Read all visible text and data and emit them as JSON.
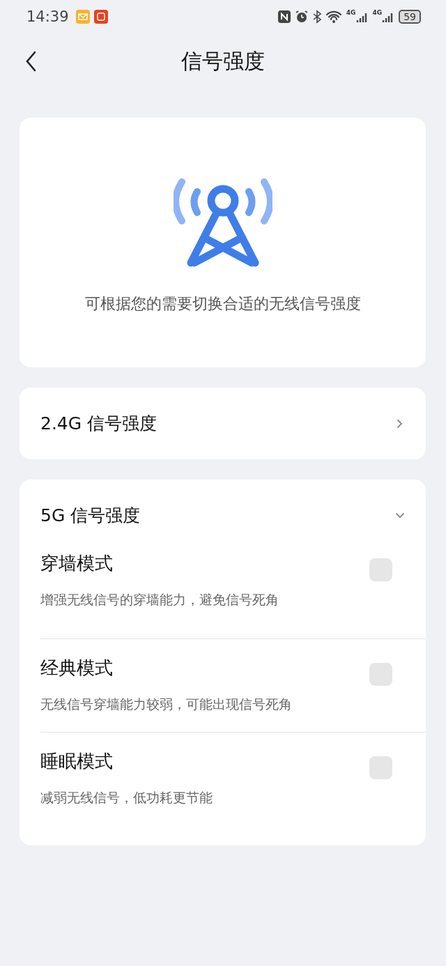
{
  "status_bar": {
    "time": "14:39",
    "signal_labels": [
      "4G",
      "4G"
    ],
    "battery": "59"
  },
  "header": {
    "title": "信号强度"
  },
  "intro": {
    "description": "可根据您的需要切换合适的无线信号强度"
  },
  "bands": [
    {
      "label": "2.4G 信号强度",
      "expanded": false
    },
    {
      "label": "5G 信号强度",
      "expanded": true,
      "modes": [
        {
          "name": "穿墙模式",
          "description": "增强无线信号的穿墙能力，避免信号死角",
          "checked": false
        },
        {
          "name": "经典模式",
          "description": "无线信号穿墙能力较弱，可能出现信号死角",
          "checked": false
        },
        {
          "name": "睡眠模式",
          "description": "减弱无线信号，低功耗更节能",
          "checked": false
        }
      ]
    }
  ]
}
